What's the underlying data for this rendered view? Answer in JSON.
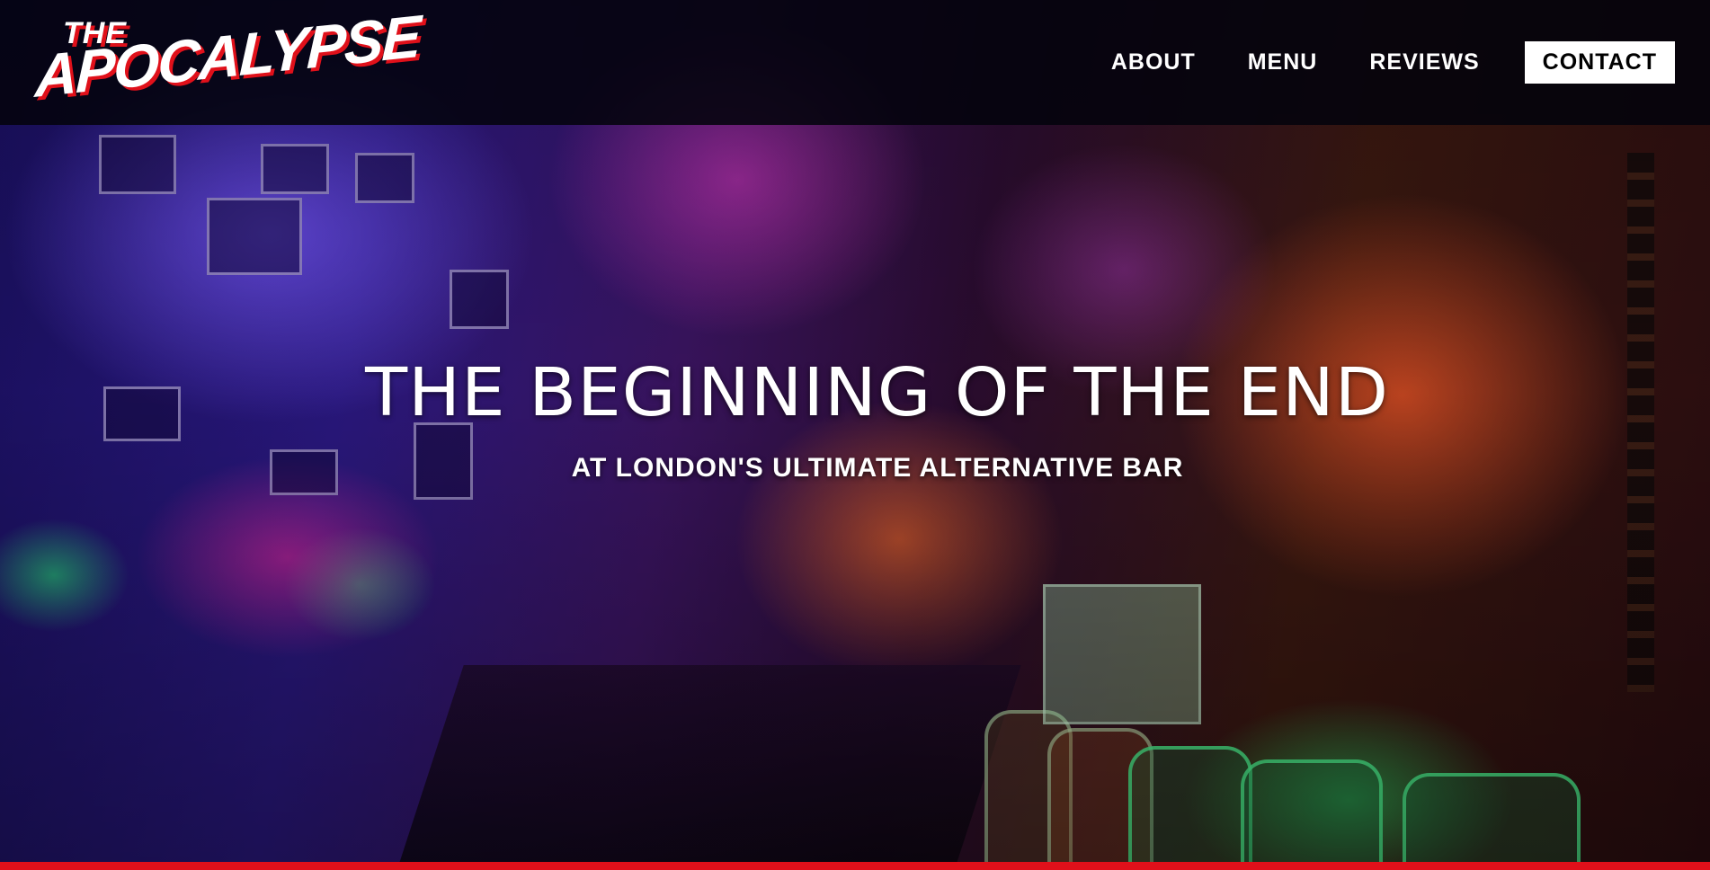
{
  "brand": {
    "logo_small": "THE",
    "logo_main": "APOCALYPSE",
    "accent_color": "#e0101a"
  },
  "nav": {
    "items": [
      {
        "label": "ABOUT"
      },
      {
        "label": "MENU"
      },
      {
        "label": "REVIEWS"
      }
    ],
    "cta_label": "CONTACT"
  },
  "hero": {
    "title": "THE BEGINNING OF THE END",
    "subtitle": "AT LONDON'S ULTIMATE ALTERNATIVE BAR",
    "background": "neon-lit bar photo"
  }
}
